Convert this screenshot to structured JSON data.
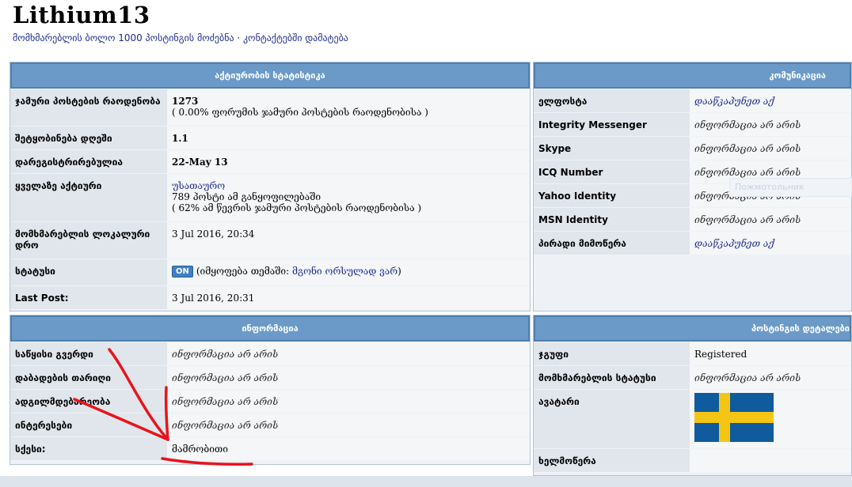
{
  "page": {
    "title": "Lithium13",
    "links": "მომხმარებლის ბოლო 1000 პოსტინგის მოძებნა · კონტაქტებში დამატება"
  },
  "activity": {
    "header": "აქტიურობის სტატისტიკა",
    "rows": [
      {
        "label": "ჯამური პოსტების რაოდენობა",
        "value": "1273",
        "sub": "( 0.00% ფორუმის ჯამური პოსტების რაოდენობისა )"
      },
      {
        "label": "შეტყობინება დღეში",
        "value": "1.1"
      },
      {
        "label": "დარეგისტრირებულია",
        "value": "22-May 13"
      },
      {
        "label": "ყველაზე აქტიური",
        "value": "უსათაურო",
        "sub1": "789 პოსტი ამ განყოფილებაში",
        "sub2": "( 62% ამ წევრის ჯამური პოსტების რაოდენობისა )"
      },
      {
        "label": "მომხმარებლის ლოკალური დრო",
        "value": "3 Jul 2016, 20:34"
      },
      {
        "label": "სტატუსი",
        "button": "ON",
        "prefix": "(იმყოფება თემაში: ",
        "link": "მგონი ორსულად ვარ",
        "suffix": ")"
      },
      {
        "label": "Last Post:",
        "value": "3 Jul 2016, 20:31"
      }
    ]
  },
  "communication": {
    "header": "კომუნიკაცია",
    "rows": [
      {
        "label": "ელფოსტა",
        "value": "დააწკაპუნეთ აქ"
      },
      {
        "label": "Integrity Messenger",
        "value": "ინფორმაცია არ არის"
      },
      {
        "label": "Skype",
        "value": "ინფორმაცია არ არის"
      },
      {
        "label": "ICQ Number",
        "value": "ინფორმაცია არ არის"
      },
      {
        "label": "Yahoo Identity",
        "value": "ინფორმაცია არ არის"
      },
      {
        "label": "MSN Identity",
        "value": "ინფორმაცია არ არის"
      },
      {
        "label": "პირადი მიმოწერა",
        "value": "დააწკაპუნეთ აქ"
      }
    ],
    "faded_overlay": "Пожмотольник"
  },
  "information": {
    "header": "ინფორმაცია",
    "rows": [
      {
        "label": "საწყისი გვერდი",
        "value": "ინფორმაცია არ არის"
      },
      {
        "label": "დაბადების თარიღი",
        "value": "ინფორმაცია არ არის"
      },
      {
        "label": "ადგილმდებარეობა",
        "value": "ინფორმაცია არ არის"
      },
      {
        "label": "ინტერესები",
        "value": "ინფორმაცია არ არის"
      },
      {
        "label": "სქესი:",
        "value": "მამრობითი"
      }
    ]
  },
  "posting": {
    "header": "პოსტინგის დეტალები",
    "rows": [
      {
        "label": "ჯგუფი",
        "value": "Registered"
      },
      {
        "label": "მომხმარებლის სტატუსი",
        "value": "ინფორმაცია არ არის"
      },
      {
        "label": "ავატარი",
        "avatar": "sweden-flag"
      },
      {
        "label": "ხელმოწერა",
        "value": ""
      }
    ]
  },
  "colors": {
    "header_bg": "#6b9ac8",
    "label_bg": "#e1e6ec",
    "value_bg": "#f4f6f8",
    "link": "#1f2c8c",
    "annotation": "#e8141c",
    "flag_blue": "#0f5b9e",
    "flag_yellow": "#f4c514"
  }
}
